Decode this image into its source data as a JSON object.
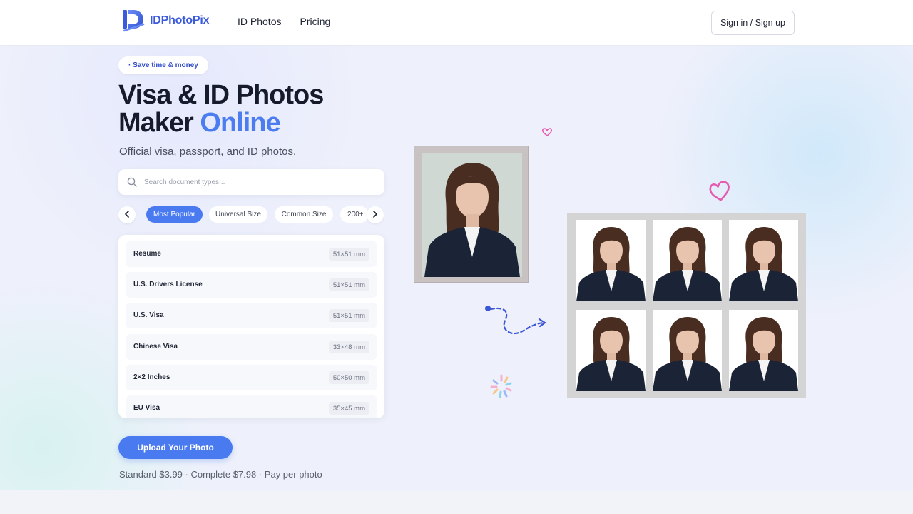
{
  "header": {
    "logo_text": "IDPhotoPix",
    "nav": [
      {
        "label": "ID Photos"
      },
      {
        "label": "Pricing"
      }
    ],
    "signin_label": "Sign in / Sign up"
  },
  "hero": {
    "badge": "· Save time & money",
    "title_line1": "Visa & ID Photos",
    "title_line2": "Maker",
    "title_accent": "Online",
    "subtitle": "Official visa, passport, and ID photos.",
    "search_placeholder": "Search document types...",
    "tabs": [
      {
        "label": "Most Popular",
        "active": true
      },
      {
        "label": "Universal Size",
        "active": false
      },
      {
        "label": "Common Size",
        "active": false
      },
      {
        "label": "200+",
        "active": false
      }
    ],
    "documents": [
      {
        "name": "Resume",
        "size": "51×51 mm"
      },
      {
        "name": "U.S. Drivers License",
        "size": "51×51 mm"
      },
      {
        "name": "U.S. Visa",
        "size": "51×51 mm"
      },
      {
        "name": "Chinese Visa",
        "size": "33×48 mm"
      },
      {
        "name": "2×2 Inches",
        "size": "50×50 mm"
      },
      {
        "name": "EU Visa",
        "size": "35×45 mm"
      }
    ],
    "upload_label": "Upload Your Photo",
    "pricing_text": "Standard $3.99 · Complete $7.98 · Pay per photo"
  },
  "icons": {
    "search": "search-icon",
    "prev": "chevron-left-icon",
    "next": "chevron-right-icon",
    "logo": "logo-icon"
  },
  "colors": {
    "accent": "#4a7af0",
    "brand": "#3b5bdb",
    "heart": "#e55bb0"
  }
}
